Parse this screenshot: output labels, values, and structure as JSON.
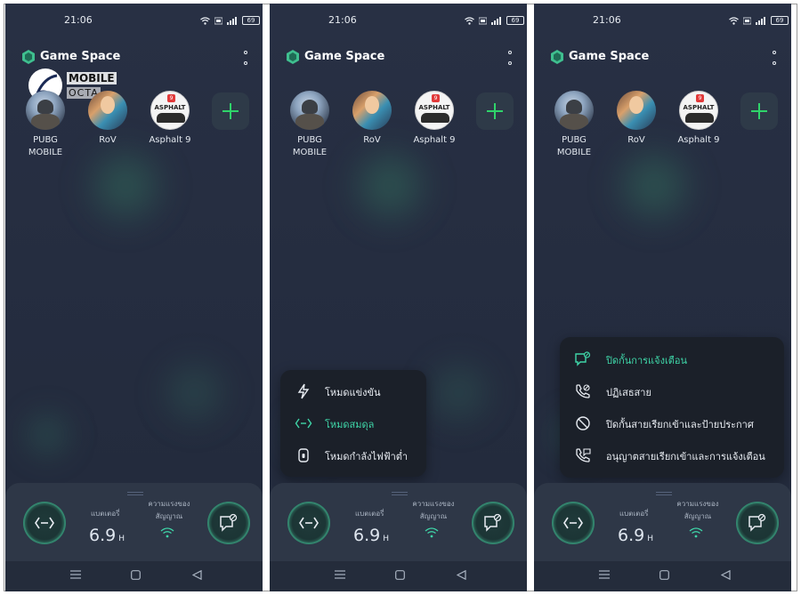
{
  "screens": [
    {
      "status": {
        "time": "21:06",
        "battery": "69"
      },
      "header": {
        "title": "Game Space",
        "logo_icon": "game-space-logo-icon",
        "more_icon": "more-vertical-icon"
      },
      "watermark": {
        "line1": "MOBILE",
        "line2": "OCTA"
      },
      "games": [
        {
          "label": "PUBG\nMOBILE",
          "icon": "pubg-mobile-icon"
        },
        {
          "label": "RoV",
          "icon": "rov-icon"
        },
        {
          "label": "Asphalt 9",
          "icon": "asphalt-9-icon",
          "badge": "9",
          "word": "ASPHALT"
        }
      ],
      "add_button": {
        "icon": "plus-icon"
      },
      "panel": {
        "battery_label": "แบตเตอรี่",
        "battery_value": "6.9",
        "battery_unit": "H",
        "signal_label": "ความแรงของ\nสัญญาณ",
        "left_icon": "balanced-mode-icon",
        "right_icon": "notification-block-icon"
      }
    },
    {
      "status": {
        "time": "21:06",
        "battery": "69"
      },
      "header": {
        "title": "Game Space",
        "logo_icon": "game-space-logo-icon",
        "more_icon": "more-vertical-icon"
      },
      "games": [
        {
          "label": "PUBG\nMOBILE",
          "icon": "pubg-mobile-icon"
        },
        {
          "label": "RoV",
          "icon": "rov-icon"
        },
        {
          "label": "Asphalt 9",
          "icon": "asphalt-9-icon",
          "badge": "9",
          "word": "ASPHALT"
        }
      ],
      "add_button": {
        "icon": "plus-icon"
      },
      "mode_menu": [
        {
          "label": "โหมดแข่งขัน",
          "icon": "lightning-icon",
          "active": false
        },
        {
          "label": "โหมดสมดุล",
          "icon": "balanced-mode-icon",
          "active": true
        },
        {
          "label": "โหมดกำลังไฟฟ้าต่ำ",
          "icon": "low-power-icon",
          "active": false
        }
      ],
      "panel": {
        "battery_label": "แบตเตอรี่",
        "battery_value": "6.9",
        "battery_unit": "H",
        "signal_label": "ความแรงของ\nสัญญาณ",
        "left_icon": "balanced-mode-icon",
        "right_icon": "notification-block-icon"
      }
    },
    {
      "status": {
        "time": "21:06",
        "battery": "69"
      },
      "header": {
        "title": "Game Space",
        "logo_icon": "game-space-logo-icon",
        "more_icon": "more-vertical-icon"
      },
      "games": [
        {
          "label": "PUBG\nMOBILE",
          "icon": "pubg-mobile-icon"
        },
        {
          "label": "RoV",
          "icon": "rov-icon"
        },
        {
          "label": "Asphalt 9",
          "icon": "asphalt-9-icon",
          "badge": "9",
          "word": "ASPHALT"
        }
      ],
      "add_button": {
        "icon": "plus-icon"
      },
      "notify_menu": [
        {
          "label": "ปิดกั้นการแจ้งเตือน",
          "icon": "notification-block-icon",
          "active": true
        },
        {
          "label": "ปฏิเสธสาย",
          "icon": "decline-call-icon",
          "active": false
        },
        {
          "label": "ปิดกั้นสายเรียกเข้าและป้ายประกาศ",
          "icon": "block-icon",
          "active": false
        },
        {
          "label": "อนุญาตสายเรียกเข้าและการแจ้งเตือน",
          "icon": "allow-call-icon",
          "active": false
        }
      ],
      "panel": {
        "battery_label": "แบตเตอรี่",
        "battery_value": "6.9",
        "battery_unit": "H",
        "signal_label": "ความแรงของ\nสัญญาณ",
        "left_icon": "balanced-mode-icon",
        "right_icon": "notification-block-icon"
      }
    }
  ],
  "navbar": {
    "menu_icon": "recent-apps-icon",
    "home_icon": "home-icon",
    "back_icon": "back-icon"
  },
  "colors": {
    "accent": "#3fd6a8",
    "add_plus": "#2fd46a",
    "background": "#252d40",
    "menu_bg": "#1b2029",
    "panel_bg": "#2e3747"
  }
}
